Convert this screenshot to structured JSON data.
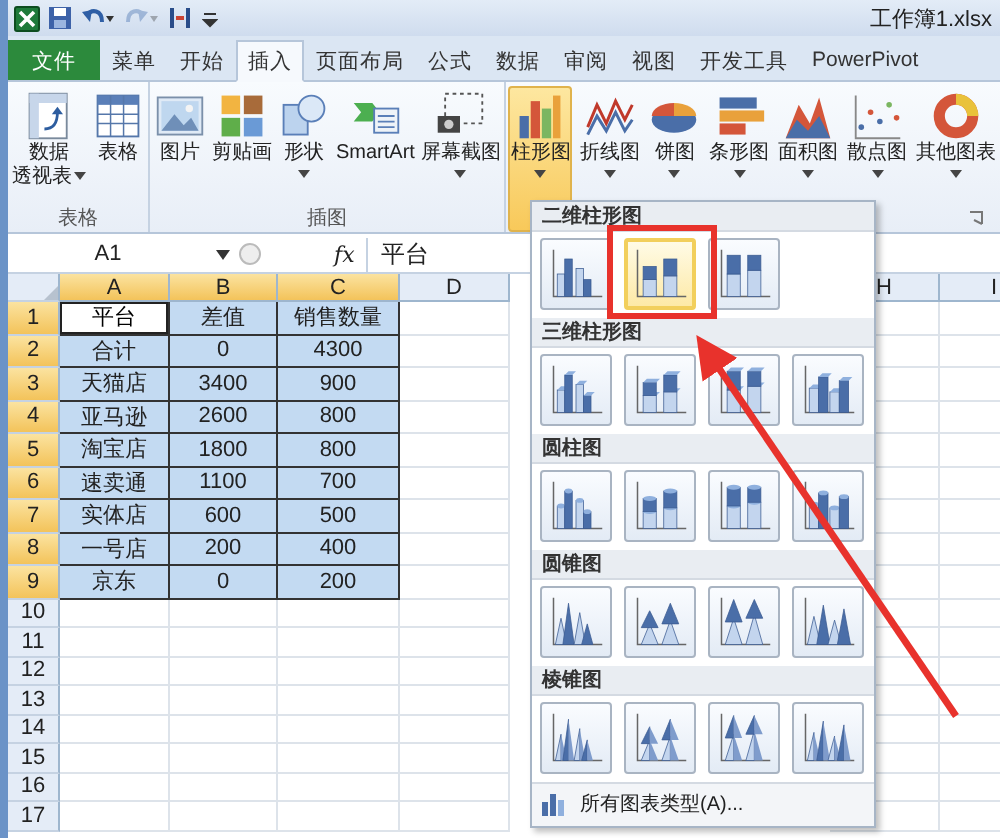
{
  "title_bar": {
    "title": "工作簿1.xlsx"
  },
  "quick_access": [
    {
      "disabled": false
    },
    {
      "disabled": false
    },
    {
      "disabled": true
    },
    {
      "disabled": false
    }
  ],
  "tabs": [
    {
      "label": "文件",
      "kind": "file",
      "selected": false
    },
    {
      "label": "菜单",
      "kind": "normal",
      "selected": false
    },
    {
      "label": "开始",
      "kind": "normal",
      "selected": false
    },
    {
      "label": "插入",
      "kind": "normal",
      "selected": true
    },
    {
      "label": "页面布局",
      "kind": "normal",
      "selected": false
    },
    {
      "label": "公式",
      "kind": "normal",
      "selected": false
    },
    {
      "label": "数据",
      "kind": "normal",
      "selected": false
    },
    {
      "label": "审阅",
      "kind": "normal",
      "selected": false
    },
    {
      "label": "视图",
      "kind": "normal",
      "selected": false
    },
    {
      "label": "开发工具",
      "kind": "normal",
      "selected": false
    },
    {
      "label": "PowerPivot",
      "kind": "normal",
      "selected": false
    }
  ],
  "ribbon": {
    "groups": [
      {
        "label": "表格",
        "buttons": [
          {
            "label_lines": [
              "数据",
              "透视表"
            ],
            "dropdown": true,
            "selected": false
          },
          {
            "label_lines": [
              "表格"
            ],
            "dropdown": false,
            "selected": false
          }
        ]
      },
      {
        "label": "插图",
        "buttons": [
          {
            "label_lines": [
              "图片"
            ],
            "dropdown": false,
            "selected": false
          },
          {
            "label_lines": [
              "剪贴画"
            ],
            "dropdown": false,
            "selected": false
          },
          {
            "label_lines": [
              "形状"
            ],
            "dropdown": true,
            "selected": false
          },
          {
            "label_lines": [
              "SmartArt"
            ],
            "dropdown": false,
            "selected": false
          },
          {
            "label_lines": [
              "屏幕截图"
            ],
            "dropdown": true,
            "selected": false
          }
        ]
      },
      {
        "buttons": [
          {
            "label_lines": [
              "柱形图"
            ],
            "dropdown": true,
            "selected": true
          },
          {
            "label_lines": [
              "折线图"
            ],
            "dropdown": true,
            "selected": false
          },
          {
            "label_lines": [
              "饼图"
            ],
            "dropdown": true,
            "selected": false
          },
          {
            "label_lines": [
              "条形图"
            ],
            "dropdown": true,
            "selected": false
          },
          {
            "label_lines": [
              "面积图"
            ],
            "dropdown": true,
            "selected": false
          },
          {
            "label_lines": [
              "散点图"
            ],
            "dropdown": true,
            "selected": false
          },
          {
            "label_lines": [
              "其他图表"
            ],
            "dropdown": true,
            "selected": false
          }
        ]
      }
    ]
  },
  "formula_bar": {
    "name_box": "A1",
    "fx_label": "fx",
    "content": "平台"
  },
  "sheet": {
    "columns": [
      {
        "label": "A",
        "selected": true
      },
      {
        "label": "B",
        "selected": true
      },
      {
        "label": "C",
        "selected": true
      },
      {
        "label": "D",
        "selected": false
      },
      {
        "label": "H",
        "selected": false
      },
      {
        "label": "I",
        "selected": false
      }
    ],
    "rows": [
      {
        "number": "1",
        "selected": true,
        "cells": [
          {
            "text": "平台",
            "active": true
          },
          {
            "text": "差值",
            "active": false
          },
          {
            "text": "销售数量",
            "active": false
          }
        ]
      },
      {
        "number": "2",
        "selected": true,
        "cells": [
          {
            "text": "合计",
            "active": false
          },
          {
            "text": "0",
            "active": false
          },
          {
            "text": "4300",
            "active": false
          }
        ]
      },
      {
        "number": "3",
        "selected": true,
        "cells": [
          {
            "text": "天猫店",
            "active": false
          },
          {
            "text": "3400",
            "active": false
          },
          {
            "text": "900",
            "active": false
          }
        ]
      },
      {
        "number": "4",
        "selected": true,
        "cells": [
          {
            "text": "亚马逊",
            "active": false
          },
          {
            "text": "2600",
            "active": false
          },
          {
            "text": "800",
            "active": false
          }
        ]
      },
      {
        "number": "5",
        "selected": true,
        "cells": [
          {
            "text": "淘宝店",
            "active": false
          },
          {
            "text": "1800",
            "active": false
          },
          {
            "text": "800",
            "active": false
          }
        ]
      },
      {
        "number": "6",
        "selected": true,
        "cells": [
          {
            "text": "速卖通",
            "active": false
          },
          {
            "text": "1100",
            "active": false
          },
          {
            "text": "700",
            "active": false
          }
        ]
      },
      {
        "number": "7",
        "selected": true,
        "cells": [
          {
            "text": "实体店",
            "active": false
          },
          {
            "text": "600",
            "active": false
          },
          {
            "text": "500",
            "active": false
          }
        ]
      },
      {
        "number": "8",
        "selected": true,
        "cells": [
          {
            "text": "一号店",
            "active": false
          },
          {
            "text": "200",
            "active": false
          },
          {
            "text": "400",
            "active": false
          }
        ]
      },
      {
        "number": "9",
        "selected": true,
        "cells": [
          {
            "text": "京东",
            "active": false
          },
          {
            "text": "0",
            "active": false
          },
          {
            "text": "200",
            "active": false
          }
        ]
      },
      {
        "number": "10",
        "selected": false
      },
      {
        "number": "11",
        "selected": false
      },
      {
        "number": "12",
        "selected": false
      },
      {
        "number": "13",
        "selected": false
      },
      {
        "number": "14",
        "selected": false
      },
      {
        "number": "15",
        "selected": false
      },
      {
        "number": "16",
        "selected": false
      },
      {
        "number": "17",
        "selected": false
      }
    ]
  },
  "chart_menu": {
    "sections": [
      {
        "title": "二维柱形图",
        "kind": "column2d",
        "options": [
          {
            "selected": false
          },
          {
            "selected": true
          },
          {
            "selected": false
          }
        ]
      },
      {
        "title": "三维柱形图",
        "kind": "column3d",
        "options": [
          {
            "selected": false
          },
          {
            "selected": false
          },
          {
            "selected": false
          },
          {
            "selected": false
          }
        ]
      },
      {
        "title": "圆柱图",
        "kind": "cylinder",
        "options": [
          {
            "selected": false
          },
          {
            "selected": false
          },
          {
            "selected": false
          },
          {
            "selected": false
          }
        ]
      },
      {
        "title": "圆锥图",
        "kind": "cone",
        "options": [
          {
            "selected": false
          },
          {
            "selected": false
          },
          {
            "selected": false
          },
          {
            "selected": false
          }
        ]
      },
      {
        "title": "棱锥图",
        "kind": "pyramid",
        "options": [
          {
            "selected": false
          },
          {
            "selected": false
          },
          {
            "selected": false
          },
          {
            "selected": false
          }
        ]
      }
    ],
    "footer": "所有图表类型(A)..."
  }
}
